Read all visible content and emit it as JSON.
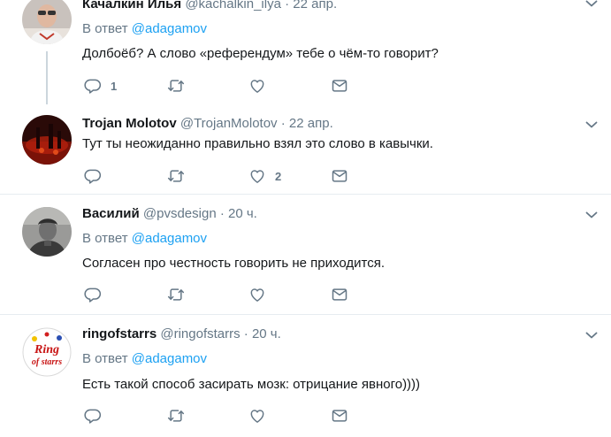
{
  "reply_prefix": "В ответ",
  "tweets": [
    {
      "name": "Качалкин Илья",
      "handle": "@kachalkin_ilya",
      "dot": "·",
      "time": "22 апр.",
      "reply_to": "@adagamov",
      "text": "Долбоёб? А слово «референдум» тебе о чём-то говорит?",
      "reply_count": "1",
      "retweet_count": "",
      "like_count": ""
    },
    {
      "name": "Trojan Molotov",
      "handle": "@TrojanMolotov",
      "dot": "·",
      "time": "22 апр.",
      "text": "Тут ты неожиданно правильно взял это слово в кавычки.",
      "reply_count": "",
      "retweet_count": "",
      "like_count": "2"
    },
    {
      "name": "Василий",
      "handle": "@pvsdesign",
      "dot": "·",
      "time": "20 ч.",
      "reply_to": "@adagamov",
      "text": "Согласен про честность говорить не приходится.",
      "reply_count": "",
      "retweet_count": "",
      "like_count": ""
    },
    {
      "name": "ringofstarrs",
      "handle": "@ringofstarrs",
      "dot": "·",
      "time": "20 ч.",
      "reply_to": "@adagamov",
      "text": "Есть такой способ засирать мозк: отрицание явного))))",
      "reply_count": "",
      "retweet_count": "",
      "like_count": "",
      "avatar_text_1": "Ring",
      "avatar_text_2": "of starrs"
    }
  ],
  "colors": {
    "text": "#14171a",
    "secondary": "#657786",
    "link": "#1da1f2",
    "divider": "#e6ecf0",
    "thread_line": "#ccd6dd"
  }
}
